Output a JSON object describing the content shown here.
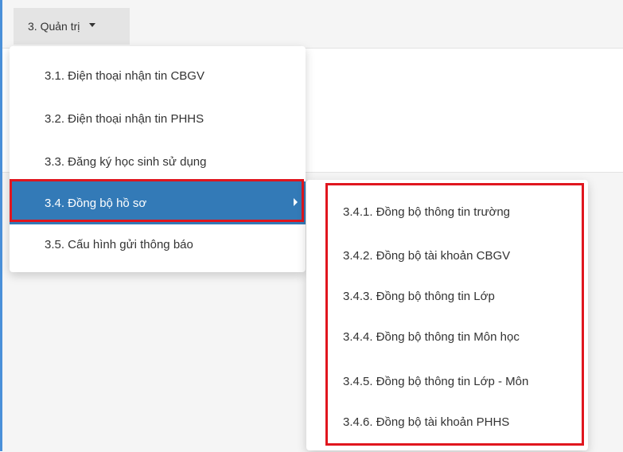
{
  "menu": {
    "label": "3. Quản trị"
  },
  "dropdown": {
    "items": [
      {
        "label": "3.1. Điện thoại nhận tin CBGV"
      },
      {
        "label": "3.2. Điện thoại nhận tin PHHS"
      },
      {
        "label": "3.3. Đăng ký học sinh sử dụng"
      },
      {
        "label": "3.4. Đồng bộ hồ sơ",
        "active": true
      },
      {
        "label": "3.5. Cấu hình gửi thông báo"
      }
    ]
  },
  "submenu": {
    "items": [
      {
        "label": "3.4.1. Đồng bộ thông tin trường"
      },
      {
        "label": "3.4.2. Đồng bộ tài khoản CBGV"
      },
      {
        "label": "3.4.3. Đồng bộ thông tin Lớp"
      },
      {
        "label": "3.4.4. Đồng bộ thông tin Môn học"
      },
      {
        "label": "3.4.5. Đồng bộ thông tin Lớp - Môn"
      },
      {
        "label": "3.4.6. Đồng bộ tài khoản PHHS"
      }
    ]
  },
  "colors": {
    "active_bg": "#337ab7",
    "highlight_border": "#e0161e",
    "frame_accent": "#4a90d9"
  },
  "icons": {
    "menu_caret": "caret-down-icon",
    "submenu_arrow": "caret-right-icon"
  }
}
